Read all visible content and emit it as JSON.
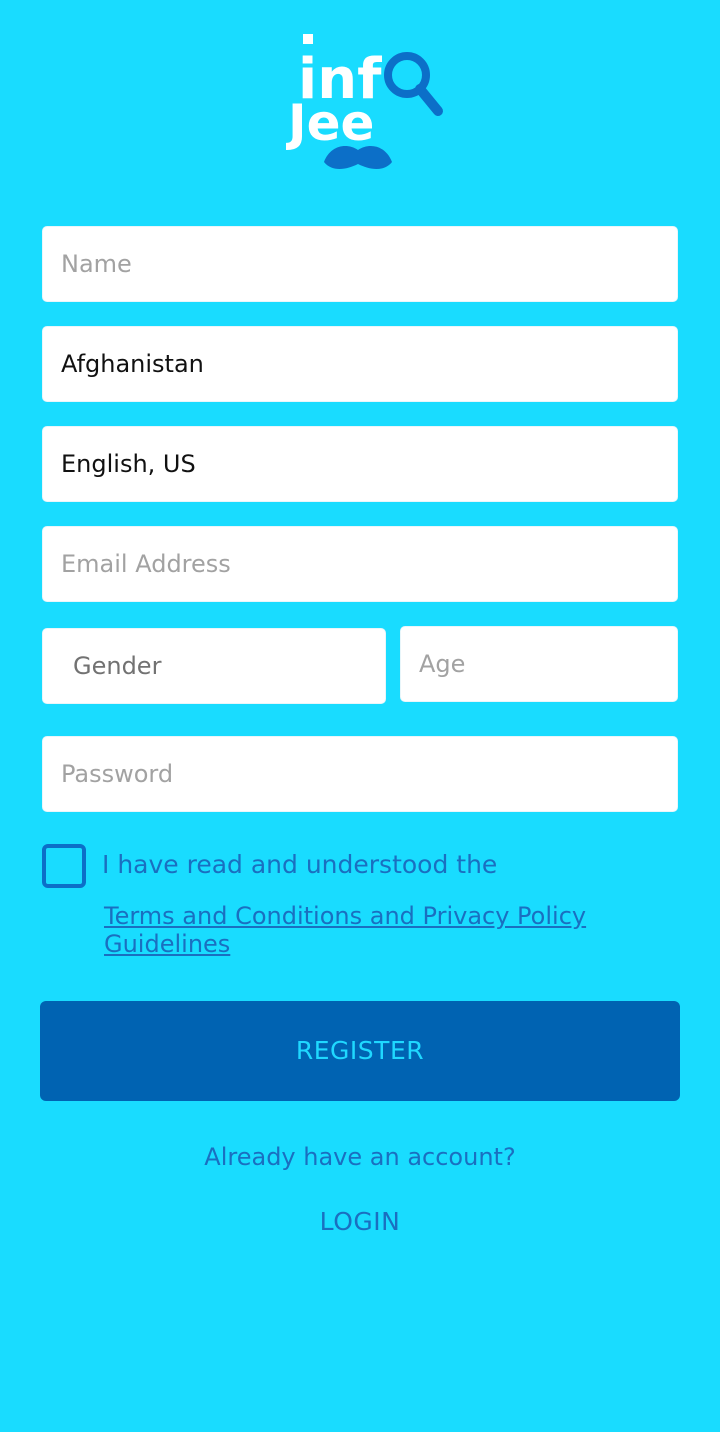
{
  "logo": {
    "text_line1": "inf",
    "text_line2": "Jee",
    "icon": "magnifier-icon",
    "decoration": "mustache-icon",
    "colors": {
      "white": "#ffffff",
      "blue": "#0c6fc8"
    }
  },
  "form": {
    "name_placeholder": "Name",
    "country_value": "Afghanistan",
    "language_value": "English, US",
    "email_placeholder": "Email Address",
    "gender_placeholder": "Gender",
    "age_placeholder": "Age",
    "password_placeholder": "Password"
  },
  "agreement": {
    "text": "I have read and understood the",
    "link": "Terms and Conditions and Privacy Policy Guidelines",
    "checked": false
  },
  "register_label": "REGISTER",
  "already_text": "Already have an account?",
  "login_label": "LOGIN",
  "colors": {
    "background": "#19dcff",
    "button": "#0063b2",
    "button_text": "#1fd8ff",
    "link": "#1a6fc0"
  }
}
